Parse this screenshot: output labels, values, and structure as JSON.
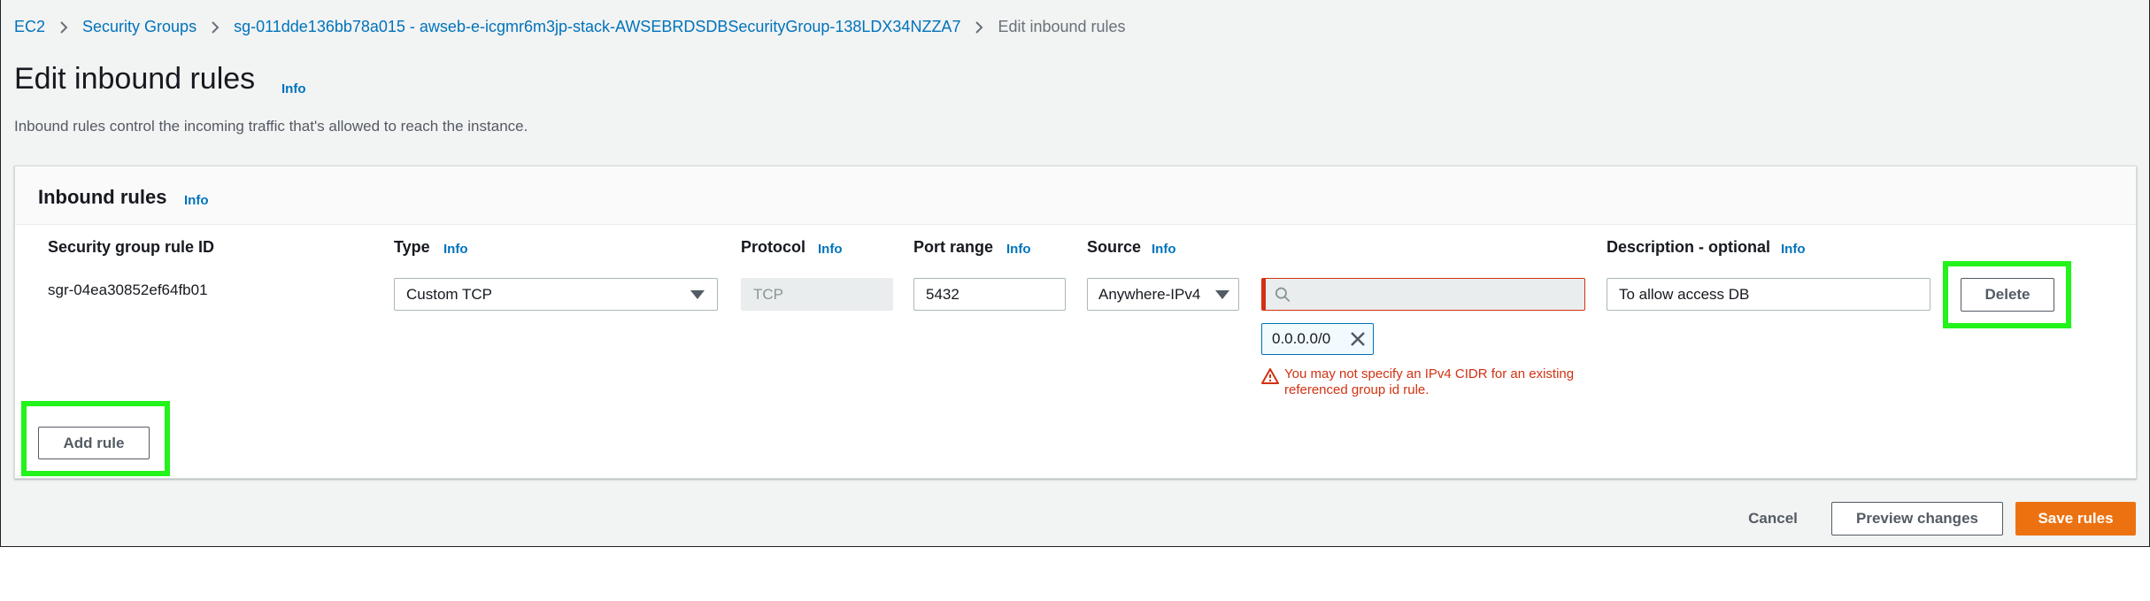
{
  "breadcrumb": {
    "items": [
      "EC2",
      "Security Groups",
      "sg-011dde136bb78a015 - awseb-e-icgmr6m3jp-stack-AWSEBRDSDBSecurityGroup-138LDX34NZZA7"
    ],
    "current": "Edit inbound rules"
  },
  "page": {
    "title": "Edit inbound rules",
    "info": "Info",
    "description": "Inbound rules control the incoming traffic that's allowed to reach the instance."
  },
  "panel": {
    "title": "Inbound rules",
    "info": "Info",
    "columns": {
      "rule_id": "Security group rule ID",
      "type": "Type",
      "protocol": "Protocol",
      "port_range": "Port range",
      "source": "Source",
      "description": "Description - optional",
      "info": "Info"
    },
    "rule": {
      "id": "sgr-04ea30852ef64fb01",
      "type": "Custom TCP",
      "protocol": "TCP",
      "port_range": "5432",
      "source": "Anywhere-IPv4",
      "source_search_value": "",
      "cidr_token": "0.0.0.0/0",
      "error": "You may not specify an IPv4 CIDR for an existing referenced group id rule.",
      "description": "To allow access DB",
      "delete_label": "Delete"
    },
    "add_rule_label": "Add rule"
  },
  "footer": {
    "cancel_label": "Cancel",
    "preview_label": "Preview changes",
    "save_label": "Save rules"
  },
  "colors": {
    "link": "#0073bb",
    "primary": "#ec7211",
    "error": "#d13212",
    "highlight": "#22f31a"
  }
}
